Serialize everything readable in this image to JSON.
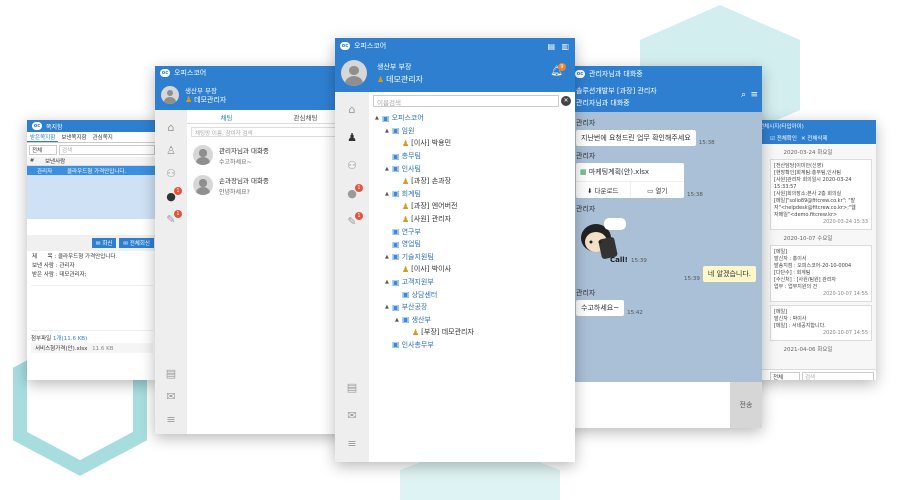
{
  "app_name": "오피스코어",
  "colors": {
    "primary": "#2f7fd1",
    "chat_bg": "#a9c0d7",
    "accent_teal": "#8fd3d8",
    "badge": "#e5533d"
  },
  "note_window": {
    "title": "쪽지함",
    "tabs": [
      "받은쪽지함",
      "보낸쪽지함",
      "관심쪽지"
    ],
    "filter_value": "전체",
    "search_placeholder": "검색",
    "columns": [
      "#",
      "보낸사람"
    ],
    "selected_row": {
      "sender": "관리자",
      "subject": "클라우드형 가격안입니다."
    },
    "reply_label": "회신",
    "reply_all_label": "전체회신",
    "detail": {
      "subject_label": "제      목 :",
      "subject_value": "클라우드형 가격안입니다.",
      "sender_label": "보낸 사람 :",
      "sender_value": "관리자",
      "receiver_label": "받은 사람 :",
      "receiver_value": "데모관리자;"
    },
    "attachment_label": "첨부파일",
    "attachment_count": "1개(11.6 KB)",
    "attachment_file": "서비스형가격(안).xlsx",
    "attachment_size": "11.6 KB"
  },
  "chat_list_window": {
    "title": "오피스코어",
    "dept_line": "생산부 부장",
    "user_name": "데모관리자",
    "tabs": [
      "채팅",
      "관심채팅"
    ],
    "search_placeholder": "채팅방 이름, 참여자 검색",
    "items": [
      {
        "title": "관리자님과 대화중",
        "preview": "수고하세요~"
      },
      {
        "title": "손과장님과 대화중",
        "preview": "안녕하세요?"
      }
    ],
    "badges": {
      "chat": "1",
      "notice": "1"
    }
  },
  "org_window": {
    "title": "오피스코어",
    "dept_line": "생산부 부장",
    "user_name": "데모관리자",
    "bell_badge": "9",
    "search_placeholder": "이름검색",
    "badges": {
      "chat": "1",
      "notice": "1"
    },
    "tree": [
      {
        "level": 0,
        "kind": "folder",
        "toggle": "▲",
        "label": "오피스코어"
      },
      {
        "level": 1,
        "kind": "folder",
        "toggle": "▲",
        "label": "임원"
      },
      {
        "level": 2,
        "kind": "person",
        "toggle": "",
        "label": "[이사] 박용민"
      },
      {
        "level": 1,
        "kind": "folder",
        "toggle": "",
        "label": "총무팀"
      },
      {
        "level": 1,
        "kind": "folder",
        "toggle": "▲",
        "label": "인사팀"
      },
      {
        "level": 2,
        "kind": "person",
        "toggle": "",
        "label": "[과장] 손과장"
      },
      {
        "level": 1,
        "kind": "folder",
        "toggle": "▲",
        "label": "회계팀"
      },
      {
        "level": 2,
        "kind": "person",
        "toggle": "",
        "label": "[과장] 엔어버전"
      },
      {
        "level": 2,
        "kind": "person",
        "toggle": "",
        "label": "[사원] 관리자"
      },
      {
        "level": 1,
        "kind": "folder",
        "toggle": "",
        "label": "연구부"
      },
      {
        "level": 1,
        "kind": "folder",
        "toggle": "",
        "label": "영업팀"
      },
      {
        "level": 1,
        "kind": "folder",
        "toggle": "▲",
        "label": "기술지원팀"
      },
      {
        "level": 2,
        "kind": "person",
        "toggle": "",
        "label": "[이사] 박이사"
      },
      {
        "level": 1,
        "kind": "folder",
        "toggle": "▲",
        "label": "고객지원부"
      },
      {
        "level": 2,
        "kind": "folder",
        "toggle": "",
        "label": "상담센터"
      },
      {
        "level": 1,
        "kind": "folder",
        "toggle": "▲",
        "label": "부산공장"
      },
      {
        "level": 2,
        "kind": "folder",
        "toggle": "▲",
        "label": "생산부"
      },
      {
        "level": 3,
        "kind": "person",
        "toggle": "",
        "label": "[부장] 데모관리자"
      },
      {
        "level": 1,
        "kind": "folder",
        "toggle": "",
        "label": "인사총무부"
      }
    ]
  },
  "chat_window": {
    "title": "관리자님과 대화중",
    "header_line1": "솔루션개발부 [과장] 관리자",
    "header_line2": "관리자님과 대화중",
    "messages": {
      "sender": "관리자",
      "m1": "지난번에 요청드린 업무 확인해주세요",
      "m1_time": "15:38",
      "file_name": "마케팅계획(안).xlsx",
      "download_label": "다운로드",
      "open_label": "열기",
      "file_time": "15:38",
      "sticker_text": "Call!",
      "sticker_time": "15:39",
      "reply": "네 알겠습니다.",
      "reply_time": "15:39",
      "m3": "수고하세요~",
      "m3_time": "15:42"
    },
    "send_label": "전송"
  },
  "notice_window": {
    "title": "전체시지(타입아이)",
    "tab_all": "전체확인",
    "tab_delete": "전체삭제",
    "dates": [
      "2020-03-24 화요일",
      "2020-10-07 수요일",
      "2021-04-06 화요일"
    ],
    "card1_lines": [
      "[전산담당]이미안(신영)",
      "[현장확인]회계팀:총무팀,인사팀",
      "[사원]관리자 회의일시 2020-03-24 15:33:57",
      "[사원]회의장소:본사 2층 회의실",
      "",
      "[메일]\"solio89@fitcrew.co.kr\"; \"발",
      "자\"<helpdesk@fitcrew.co.kr>;\"웹",
      "자메일\"<demo.fitcrew.kr>"
    ],
    "card1_time": "2020-03-24 15:33",
    "card2_lines": [
      "[메일]",
      "발신자 : 홍이서",
      "발송지점 : 오피스코어-20-10-0004",
      "[다단수] : 회계팀",
      "[수신처] : [사원/팀원] 관리자",
      "업무 : 업무지원의 건",
      "[사원] 회의일",
      "[사원] : 박이사"
    ],
    "card2_time": "2020-10-07 14:55",
    "card3_lines": [
      "[메일]",
      "발신자 : 박이사",
      "[메일] : 서네공지합니다."
    ],
    "card3_time": "2020-10-07 14:55",
    "filter_value": "전체",
    "search_placeholder": "검색"
  }
}
